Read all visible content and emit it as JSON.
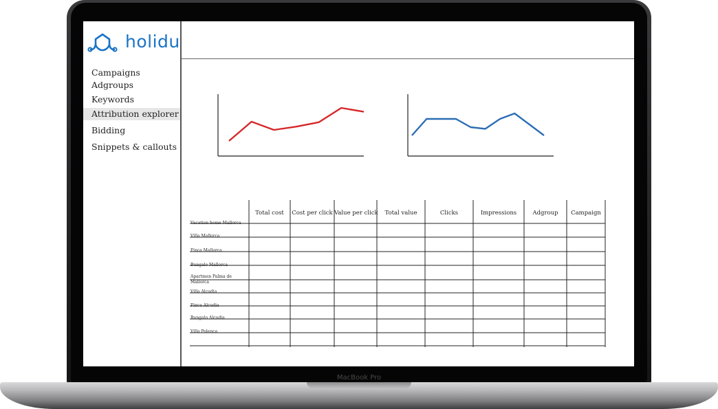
{
  "device": {
    "model_label": "MacBook Pro"
  },
  "brand": {
    "name": "holidu",
    "color": "#1a73c8"
  },
  "sidebar": {
    "items": [
      {
        "label": "Campaigns",
        "active": false
      },
      {
        "label": "Adgroups",
        "active": false
      },
      {
        "label": "Keywords",
        "active": false
      },
      {
        "label": "Attribution explorer",
        "active": true
      },
      {
        "label": "Bidding",
        "active": false
      },
      {
        "label": "Snippets & callouts",
        "active": false
      }
    ]
  },
  "chart_data": [
    {
      "type": "line",
      "color": "#d62728",
      "axes_labels": false,
      "x": [
        0,
        1,
        2,
        3,
        4,
        5,
        6
      ],
      "values": [
        2,
        5.5,
        4,
        4.6,
        5.4,
        8,
        7.3
      ],
      "ylim": [
        0,
        10
      ]
    },
    {
      "type": "line",
      "color": "#2a6db5",
      "axes_labels": false,
      "x": [
        0,
        1,
        2,
        3,
        4,
        5,
        6,
        7,
        8,
        9
      ],
      "values": [
        3,
        6,
        6,
        6,
        4.5,
        4.2,
        6,
        7,
        5,
        3
      ],
      "ylim": [
        0,
        10
      ]
    }
  ],
  "table": {
    "columns": [
      "Total cost",
      "Cost per click",
      "Value per click",
      "Total value",
      "Clicks",
      "Impressions",
      "Adgroup",
      "Campaign"
    ],
    "rows": [
      "Vacation home Mallorca",
      "Villa Mallorca",
      "Finca Mallorca",
      "Bungalo Mallorca",
      "Apartmen Palma de Mallorca",
      "Villa Alcudia",
      "Finca Alcudia",
      "Bungalo Alcudia",
      "Villa Polenca"
    ]
  }
}
